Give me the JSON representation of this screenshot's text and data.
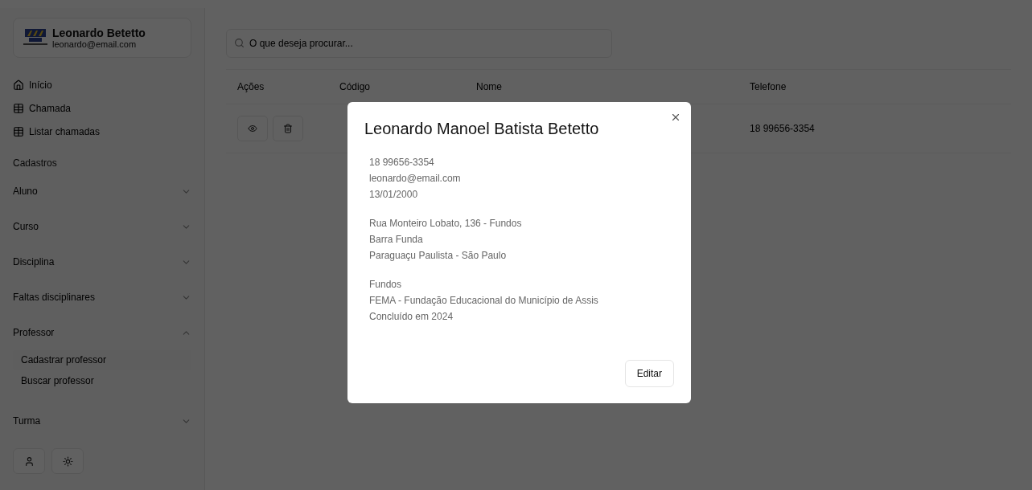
{
  "user": {
    "name": "Leonardo Betetto",
    "email": "leonardo@email.com"
  },
  "nav": [
    {
      "kind": "home",
      "label": "Início"
    },
    {
      "kind": "table",
      "label": "Chamada"
    },
    {
      "kind": "table",
      "label": "Listar chamadas"
    }
  ],
  "section_label": "Cadastros",
  "groups": [
    {
      "label": "Aluno",
      "expanded": false
    },
    {
      "label": "Curso",
      "expanded": false
    },
    {
      "label": "Disciplina",
      "expanded": false
    },
    {
      "label": "Faltas disciplinares",
      "expanded": false
    },
    {
      "label": "Professor",
      "expanded": true,
      "children": [
        {
          "label": "Cadastrar professor",
          "selected": true
        },
        {
          "label": "Buscar professor",
          "selected": false
        }
      ]
    },
    {
      "label": "Turma",
      "expanded": false
    }
  ],
  "search": {
    "placeholder": "O que deseja procurar..."
  },
  "table": {
    "columns": [
      "Ações",
      "Código",
      "Nome",
      "Telefone"
    ],
    "rows": [
      {
        "telefone": "18 99656-3354"
      }
    ]
  },
  "modal": {
    "title": "Leonardo Manoel Batista Betetto",
    "sections": [
      [
        "18 99656-3354",
        "leonardo@email.com",
        "13/01/2000"
      ],
      [
        "Rua Monteiro Lobato, 136 - Fundos",
        "Barra Funda",
        "Paraguaçu Paulista - São Paulo"
      ],
      [
        "Fundos",
        "FEMA - Fundação Educacional do Município de Assis",
        "Concluído em 2024"
      ]
    ],
    "button": "Editar"
  }
}
